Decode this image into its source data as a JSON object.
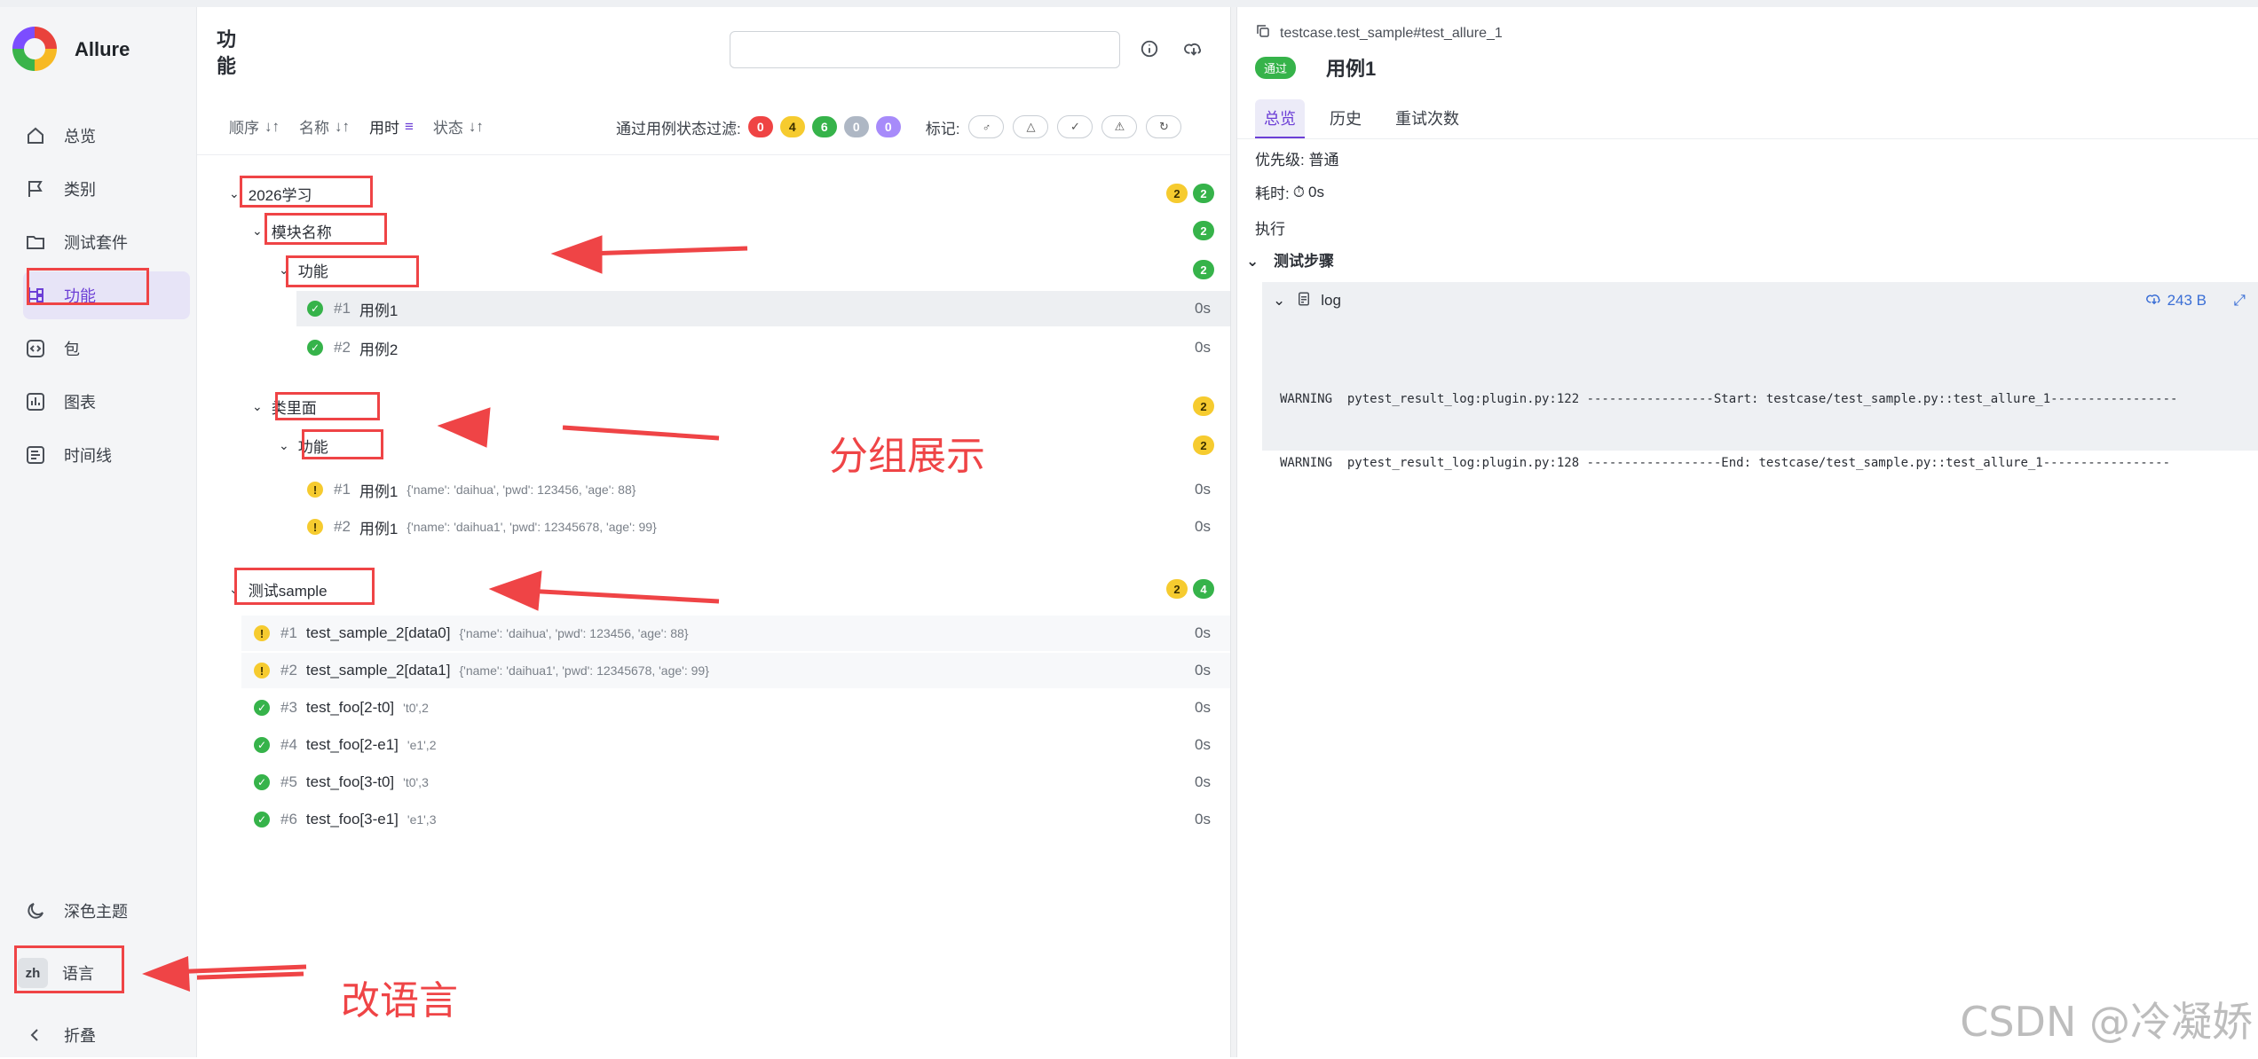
{
  "sidebar": {
    "brand": "Allure",
    "items": [
      {
        "label": "总览",
        "icon": "home-icon"
      },
      {
        "label": "类别",
        "icon": "flag-icon"
      },
      {
        "label": "测试套件",
        "icon": "folder-icon"
      },
      {
        "label": "功能",
        "icon": "tree-icon",
        "active": true
      },
      {
        "label": "包",
        "icon": "code-icon"
      },
      {
        "label": "图表",
        "icon": "chart-icon"
      },
      {
        "label": "时间线",
        "icon": "timeline-icon"
      }
    ],
    "dark_theme": "深色主题",
    "lang_code": "zh",
    "language": "语言",
    "collapse": "折叠"
  },
  "main": {
    "title": "功能",
    "sort": [
      {
        "label": "顺序",
        "arrow": "↓↑"
      },
      {
        "label": "名称",
        "arrow": "↓↑"
      },
      {
        "label": "用时",
        "arrow": "≡"
      },
      {
        "label": "状态",
        "arrow": "↓↑"
      }
    ],
    "filter_label": "通过用例状态过滤:",
    "filter_counts": [
      "0",
      "4",
      "6",
      "0",
      "0"
    ],
    "marks_label": "标记:",
    "tree": {
      "group1": {
        "name": "2026学习",
        "counts": [
          "2",
          "2"
        ]
      },
      "group1_sub": {
        "name": "模块名称",
        "count": "2"
      },
      "group1_sub_sub": {
        "name": "功能",
        "count": "2"
      },
      "group1_cases": [
        {
          "num": "#1",
          "name": "用例1",
          "dur": "0s"
        },
        {
          "num": "#2",
          "name": "用例2",
          "dur": "0s"
        }
      ],
      "group2": {
        "name": "类里面",
        "count": "2"
      },
      "group2_sub": {
        "name": "功能",
        "count": "2"
      },
      "group2_cases": [
        {
          "num": "#1",
          "name": "用例1",
          "params": "{'name': 'daihua', 'pwd': 123456, 'age': 88}",
          "dur": "0s"
        },
        {
          "num": "#2",
          "name": "用例1",
          "params": "{'name': 'daihua1', 'pwd': 12345678, 'age': 99}",
          "dur": "0s"
        }
      ],
      "group3": {
        "name": "测试sample",
        "counts": [
          "2",
          "4"
        ]
      },
      "group3_cases": [
        {
          "num": "#1",
          "name": "test_sample_2[data0]",
          "params": "{'name': 'daihua', 'pwd': 123456, 'age': 88}",
          "dur": "0s"
        },
        {
          "num": "#2",
          "name": "test_sample_2[data1]",
          "params": "{'name': 'daihua1', 'pwd': 12345678, 'age': 99}",
          "dur": "0s"
        },
        {
          "num": "#3",
          "name": "test_foo[2-t0]",
          "params": "'t0',2",
          "dur": "0s"
        },
        {
          "num": "#4",
          "name": "test_foo[2-e1]",
          "params": "'e1',2",
          "dur": "0s"
        },
        {
          "num": "#5",
          "name": "test_foo[3-t0]",
          "params": "'t0',3",
          "dur": "0s"
        },
        {
          "num": "#6",
          "name": "test_foo[3-e1]",
          "params": "'e1',3",
          "dur": "0s"
        }
      ]
    },
    "annotations": {
      "grouping": "分组展示",
      "change_language": "改语言"
    }
  },
  "detail": {
    "path": "testcase.test_sample#test_allure_1",
    "status": "通过",
    "title": "用例1",
    "tabs": [
      "总览",
      "历史",
      "重试次数"
    ],
    "priority": "优先级: 普通",
    "duration_label": "耗时:",
    "duration": "0s",
    "execution": "执行",
    "steps_header": "测试步骤",
    "log_name": "log",
    "log_size": "243 B",
    "log_lines": [
      "WARNING  pytest_result_log:plugin.py:122 -----------------Start: testcase/test_sample.py::test_allure_1-----------------",
      "WARNING  pytest_result_log:plugin.py:128 ------------------End: testcase/test_sample.py::test_allure_1-----------------"
    ]
  },
  "watermark": "CSDN @冷凝娇",
  "colors": {
    "accent": "#6c3fd6",
    "passed": "#36b34a",
    "broken": "#f6cb2f",
    "failed": "#ef4444",
    "annotation": "#ef4446"
  }
}
